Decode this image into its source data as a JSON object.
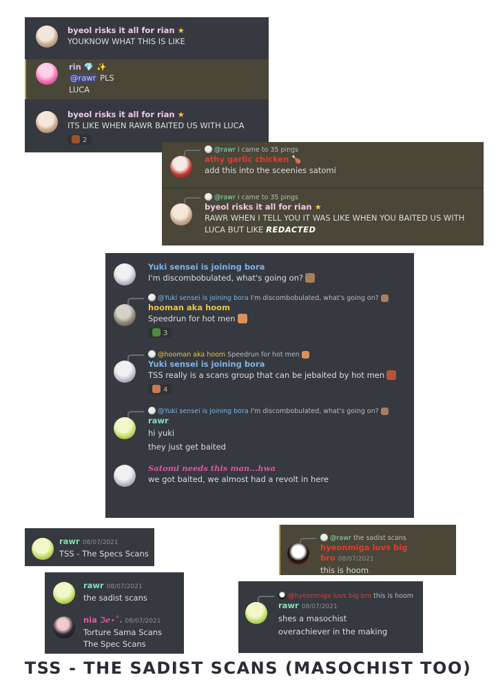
{
  "panel1": {
    "m1": {
      "name": "byeol risks it all for rian",
      "badge": "★",
      "text": "YOUKNOW WHAT THIS IS LIKE"
    },
    "m2": {
      "name": "rin",
      "badge1": "💎",
      "badge2": "✨",
      "mention": "@rawr",
      "text_after": "PLS",
      "line2": "LUCA"
    },
    "m3": {
      "name": "byeol risks it all for rian",
      "badge": "★",
      "text": "ITS LIKE WHEN RAWR BAITED US WITH LUCA",
      "reaction_count": "2"
    }
  },
  "panel2": {
    "m1": {
      "reply_user": "@rawr",
      "reply_text": "i came to 35 pings",
      "name": "athy garlic chicken",
      "badge": "🍗",
      "text": "add this into the sceenies satomi"
    },
    "m2": {
      "reply_user": "@rawr",
      "reply_text": "i came to 35 pings",
      "name": "byeol risks it all for rian",
      "badge": "★",
      "text": "RAWR WHEN I TELL YOU IT WAS LIKE WHEN YOU BAITED US WITH LUCA BUT LIKE",
      "redacted": "REDACTED"
    }
  },
  "panel3": {
    "m1": {
      "name": "Yuki sensei is joining bora",
      "text": "I'm discombobulated, what's going on?"
    },
    "m2": {
      "reply_user": "@Yuki sensei is joining bora",
      "reply_text": "I'm discombobulated, what's going on?",
      "name": "hooman aka hoom",
      "text": "Speedrun for hot men",
      "reaction_count": "3"
    },
    "m3": {
      "reply_user": "@hooman aka hoom",
      "reply_text": "Speedrun for hot men",
      "name": "Yuki sensei is joining bora",
      "text": "TSS really is a scans group that can be jebaited by hot men",
      "reaction_count": "4"
    },
    "m4": {
      "reply_user": "@Yuki sensei is joining bora",
      "reply_text": "I'm discombobulated, what's going on?",
      "name": "rawr",
      "line1": "hi yuki",
      "line2": "they just get baited"
    },
    "m5": {
      "name": "Satomi needs this man...hwa",
      "text": "we got baited, we almost had a revolt in here"
    }
  },
  "panel4": {
    "name": "rawr",
    "date": "08/07/2021",
    "text": "TSS - The Specs Scans"
  },
  "panel5": {
    "reply_user": "@rawr",
    "reply_text": "the sadist scans",
    "name": "hyeonmiga luvs big bro",
    "date": "08/07/2021",
    "text": "this is hoom"
  },
  "panel6": {
    "m1": {
      "name": "rawr",
      "date": "08/07/2021",
      "text": "the sadist scans"
    },
    "m2": {
      "name": "nia ℑℯ⋆˚.",
      "date": "08/07/2021",
      "line1": "Torture Sama Scans",
      "line2": "The Spec Scans"
    }
  },
  "panel7": {
    "reply_user": "@hyeonmiga luvs big bro",
    "reply_text": "this is hoom",
    "name": "rawr",
    "date": "08/07/2021",
    "line1": "shes a masochist",
    "line2": "overachiever in the making"
  },
  "caption": "TSS - THE SADIST SCANS (MASOCHIST TOO)"
}
